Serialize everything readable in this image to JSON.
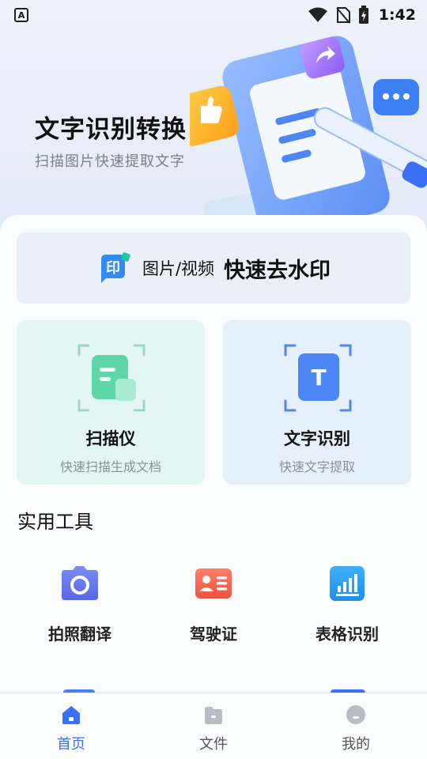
{
  "status_bar": {
    "time": "1:42",
    "badge": "A"
  },
  "hero": {
    "title": "文字识别转换",
    "subtitle": "扫描图片快速提取文字"
  },
  "banner": {
    "prefix": "图片/视频",
    "main": "快速去水印",
    "logo_char": "印"
  },
  "feature_cards": [
    {
      "title": "扫描仪",
      "desc": "快速扫描生成文档"
    },
    {
      "title": "文字识别",
      "desc": "快速文字提取",
      "icon_char": "T"
    }
  ],
  "tools": {
    "section_title": "实用工具",
    "items": [
      {
        "label": "拍照翻译",
        "icon": "camera-icon"
      },
      {
        "label": "驾驶证",
        "icon": "id-card-icon"
      },
      {
        "label": "表格识别",
        "icon": "table-chart-icon"
      }
    ]
  },
  "tabbar": {
    "items": [
      {
        "label": "首页",
        "icon": "home-icon",
        "active": true
      },
      {
        "label": "文件",
        "icon": "folder-icon",
        "active": false
      },
      {
        "label": "我的",
        "icon": "profile-icon",
        "active": false
      }
    ]
  },
  "colors": {
    "accent": "#3b6ff5",
    "scan_card": "#e4f6f3",
    "ocr_card": "#e6f0fb"
  }
}
